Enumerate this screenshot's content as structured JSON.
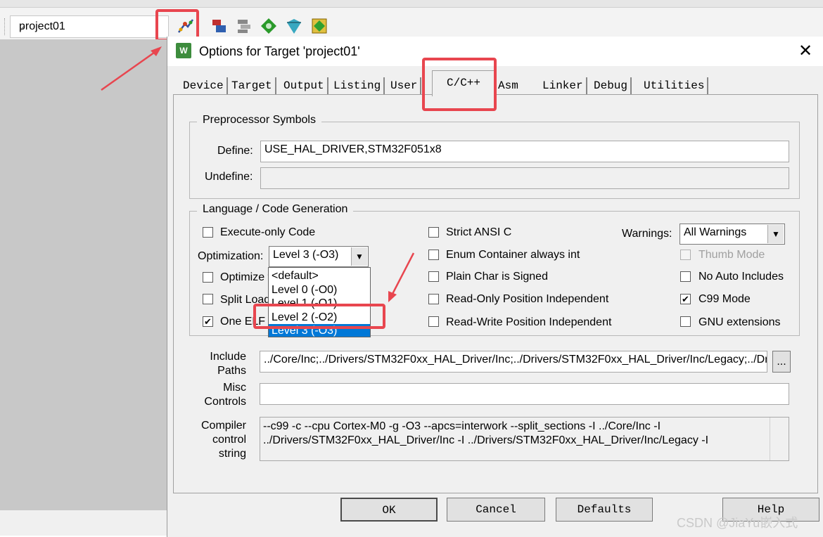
{
  "ide": {
    "target_name": "project01"
  },
  "dialog": {
    "title": "Options for Target 'project01'",
    "icon_text": "W",
    "tabs": [
      "Device",
      "Target",
      "Output",
      "Listing",
      "User",
      "C/C++",
      "Asm",
      "Linker",
      "Debug",
      "Utilities"
    ],
    "active_tab": "C/C++",
    "preprocessor": {
      "group_label": "Preprocessor Symbols",
      "define_label": "Define:",
      "define_value": "USE_HAL_DRIVER,STM32F051x8",
      "undefine_label": "Undefine:",
      "undefine_value": ""
    },
    "codegen": {
      "group_label": "Language / Code Generation",
      "execute_only": {
        "label": "Execute-only Code",
        "checked": false
      },
      "optimization_label": "Optimization:",
      "optimization_value": "Level 3 (-O3)",
      "optimization_options": [
        "<default>",
        "Level 0 (-O0)",
        "Level 1 (-O1)",
        "Level 2 (-O2)",
        "Level 3 (-O3)"
      ],
      "optimize_for_time": {
        "label": "Optimize f",
        "checked": false
      },
      "split_load": {
        "label": "Split Load",
        "checked": false
      },
      "one_elf": {
        "label": "One ELF",
        "checked": true
      },
      "strict_ansi": {
        "label": "Strict ANSI C",
        "checked": false
      },
      "enum_container": {
        "label": "Enum Container always int",
        "checked": false
      },
      "plain_char": {
        "label": "Plain Char is Signed",
        "checked": false
      },
      "ro_pi": {
        "label": "Read-Only Position Independent",
        "checked": false
      },
      "rw_pi": {
        "label": "Read-Write Position Independent",
        "checked": false
      },
      "warnings_label": "Warnings:",
      "warnings_value": "All Warnings",
      "thumb_mode": {
        "label": "Thumb Mode",
        "checked": false,
        "disabled": true
      },
      "no_auto_includes": {
        "label": "No Auto Includes",
        "checked": false
      },
      "c99_mode": {
        "label": "C99 Mode",
        "checked": true
      },
      "gnu_extensions": {
        "label": "GNU extensions",
        "checked": false
      }
    },
    "include_paths": {
      "label_line1": "Include",
      "label_line2": "Paths",
      "value": "../Core/Inc;../Drivers/STM32F0xx_HAL_Driver/Inc;../Drivers/STM32F0xx_HAL_Driver/Inc/Legacy;../Driv",
      "browse_label": "..."
    },
    "misc_controls": {
      "label_line1": "Misc",
      "label_line2": "Controls",
      "value": ""
    },
    "compiler_control": {
      "label_line1": "Compiler",
      "label_line2": "control",
      "label_line3": "string",
      "line1": "--c99 -c --cpu Cortex-M0 -g -O3 --apcs=interwork --split_sections -I ../Core/Inc -I",
      "line2": "../Drivers/STM32F0xx_HAL_Driver/Inc -I ../Drivers/STM32F0xx_HAL_Driver/Inc/Legacy -I"
    },
    "buttons": {
      "ok": "OK",
      "cancel": "Cancel",
      "defaults": "Defaults",
      "help": "Help"
    }
  },
  "watermark": "CSDN @JiaYu嵌入式",
  "colors": {
    "highlight": "#e8464f",
    "selection": "#0078d7"
  }
}
